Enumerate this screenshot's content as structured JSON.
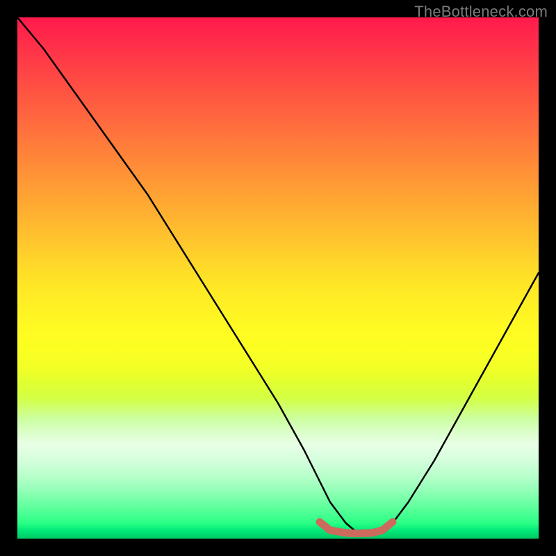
{
  "watermark": "TheBottleneck.com",
  "chart_data": {
    "type": "line",
    "title": "",
    "xlabel": "",
    "ylabel": "",
    "xlim": [
      0,
      100
    ],
    "ylim": [
      0,
      100
    ],
    "grid": false,
    "background_gradient": {
      "direction": "top_to_bottom",
      "stops": [
        {
          "pos": 0,
          "color": "#ff1a4d"
        },
        {
          "pos": 50,
          "color": "#ffe024"
        },
        {
          "pos": 75,
          "color": "#eaff30"
        },
        {
          "pos": 100,
          "color": "#00c864"
        }
      ]
    },
    "series": [
      {
        "name": "bottleneck-curve",
        "color": "#000000",
        "x": [
          0,
          5,
          10,
          15,
          20,
          25,
          30,
          35,
          40,
          45,
          50,
          55,
          58,
          60,
          63,
          65,
          68,
          70,
          72,
          75,
          80,
          85,
          90,
          95,
          100
        ],
        "y": [
          100,
          94,
          87,
          80,
          73,
          66,
          58,
          50,
          42,
          34,
          26,
          17,
          11,
          7,
          3,
          1.3,
          1,
          1.3,
          3,
          7,
          15,
          24,
          33,
          42,
          51
        ]
      }
    ],
    "markers": [
      {
        "name": "optimal-range",
        "color": "#cc6a5e",
        "shape": "flat-u",
        "x": [
          58,
          60,
          63,
          65,
          68,
          70,
          72
        ],
        "y": [
          3.2,
          1.6,
          1.1,
          1.0,
          1.1,
          1.6,
          3.2
        ]
      }
    ]
  }
}
